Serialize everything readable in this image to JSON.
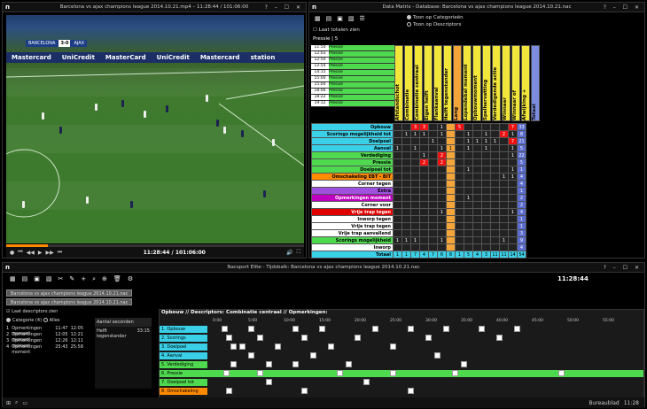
{
  "video": {
    "title": "Barcelona vs ajax champions league 2014.10.21.mp4 – 11:28:44 / 101:06:00",
    "logo": "n",
    "controls": "?  –  ☐  ✕",
    "time": "11:28:44 / 101:06:00",
    "score_home": "BARCELONA",
    "score_num": "3-0",
    "score_away": "AJAX",
    "ads": [
      "Mastercard",
      "UniCredit",
      "MasterCard",
      "UniCredit",
      "Mastercard",
      "station"
    ],
    "progress": 0.14
  },
  "matrix": {
    "title": "Data Matrix - Database: Barcelona vs ajax champions league 2014.10.21.nac",
    "logo": "n",
    "controls": "?  –  ☐  ✕",
    "radio1": "Toon op Categorieën",
    "radio2": "Toon op Descriptors",
    "checkbox": "Laat totalen zien",
    "sub": "Pressie | 5",
    "playlist": [
      [
        "11:50",
        "Pressie"
      ],
      [
        "12:03",
        "Pressie"
      ],
      [
        "12:50",
        "Pressie"
      ],
      [
        "12:54",
        "Pressie"
      ],
      [
        "14:15",
        "Pressie"
      ],
      [
        "15:00",
        "Pressie"
      ],
      [
        "15:04",
        "Pressie"
      ],
      [
        "18:06",
        "Pressie"
      ],
      [
        "18:22",
        "Pressie"
      ],
      [
        "19:12",
        "Pressie"
      ]
    ],
    "columns": [
      "Afstandschot",
      "Combinatie",
      "Combinatie centraal",
      "Eigen helft",
      "Flankaanval",
      "Helft tegenstander",
      "Lang",
      "Lopendebal moment",
      "Opbouwmoment",
      "Spelhervatting",
      "Verdedigende actie",
      "Winnaar",
      "Winnaar of",
      "Afwijking +",
      "Totaal"
    ],
    "rows": [
      {
        "label": "Opbouw",
        "color": "#3ad1e8",
        "cells": [
          "",
          "",
          "3",
          "3",
          "",
          "1",
          "",
          "5",
          "",
          "",
          "",
          "",
          "",
          "7",
          "33"
        ]
      },
      {
        "label": "Scorings mogelijkheid tot",
        "color": "#3ad1e8",
        "cells": [
          "",
          "1",
          "1",
          "1",
          "",
          "1",
          "",
          "",
          "1",
          "",
          "1",
          "",
          "2",
          "1",
          "8"
        ]
      },
      {
        "label": "Doelpoel",
        "color": "#3ad1e8",
        "cells": [
          "",
          "",
          "",
          "",
          "1",
          "",
          "",
          "",
          "1",
          "1",
          "1",
          "1",
          "",
          "7",
          "21"
        ]
      },
      {
        "label": "Aanval",
        "color": "#3ad1e8",
        "cells": [
          "1",
          "",
          "1",
          "",
          "",
          "1",
          "1",
          "",
          "1",
          "",
          "1",
          "",
          "",
          "1",
          "5"
        ]
      },
      {
        "label": "Verdediging",
        "color": "#4fd94f",
        "cells": [
          "",
          "",
          "",
          "1",
          "",
          "2",
          "",
          "",
          "",
          "",
          "",
          "",
          "",
          "1",
          "22"
        ]
      },
      {
        "label": "Pressie",
        "color": "#4fd94f",
        "cells": [
          "",
          "",
          "",
          "2",
          "",
          "2",
          "",
          "",
          "",
          "",
          "",
          "",
          "",
          "",
          "5"
        ]
      },
      {
        "label": "Doelpoel tot",
        "color": "#4fd94f",
        "cells": [
          "",
          "",
          "",
          "",
          "",
          "",
          "",
          "",
          "1",
          "",
          "",
          "",
          "",
          "1",
          "1"
        ]
      },
      {
        "label": "Omschakeling EBT - BIT",
        "color": "#ff8a00",
        "cells": [
          "",
          "",
          "",
          "",
          "",
          "",
          "",
          "",
          "",
          "",
          "",
          "",
          "1",
          "1",
          "4"
        ]
      },
      {
        "label": "Corner tegen",
        "color": "#fff",
        "cells": [
          "",
          "",
          "",
          "",
          "",
          "",
          "",
          "",
          "",
          "",
          "",
          "",
          "",
          "",
          "4"
        ]
      },
      {
        "label": "Extra",
        "color": "#a050e0",
        "cells": [
          "",
          "",
          "",
          "",
          "",
          "",
          "",
          "",
          "",
          "",
          "",
          "",
          "",
          "",
          "1"
        ]
      },
      {
        "label": "Opmerkingen moment",
        "color": "#c000c0",
        "cells": [
          "",
          "",
          "",
          "",
          "",
          "",
          "",
          "",
          "1",
          "",
          "",
          "",
          "",
          "",
          "2"
        ]
      },
      {
        "label": "Corner voor",
        "color": "#fff",
        "cells": [
          "",
          "",
          "",
          "",
          "",
          "",
          "",
          "",
          "",
          "",
          "",
          "",
          "",
          "",
          "2"
        ]
      },
      {
        "label": "Vrije trap tegen",
        "color": "#e00000",
        "cells": [
          "",
          "",
          "",
          "",
          "",
          "1",
          "",
          "",
          "",
          "",
          "",
          "",
          "",
          "1",
          "4"
        ]
      },
      {
        "label": "Inworp tegen",
        "color": "#fff",
        "cells": [
          "",
          "",
          "",
          "",
          "",
          "",
          "",
          "",
          "",
          "",
          "",
          "",
          "",
          "",
          "1"
        ]
      },
      {
        "label": "Vrije trap tegen",
        "color": "#fff",
        "cells": [
          "",
          "",
          "",
          "",
          "",
          "",
          "",
          "",
          "",
          "",
          "",
          "",
          "",
          "",
          "1"
        ]
      },
      {
        "label": "Vrije trap aanvallend",
        "color": "#fff",
        "cells": [
          "",
          "",
          "",
          "",
          "",
          "",
          "",
          "",
          "",
          "",
          "",
          "",
          "",
          "",
          "3"
        ]
      },
      {
        "label": "Scorings mogelijkheid",
        "color": "#4fd94f",
        "cells": [
          "1",
          "1",
          "1",
          "",
          "",
          "1",
          "",
          "",
          "",
          "",
          "",
          "",
          "1",
          "",
          "9"
        ]
      },
      {
        "label": "Inworp",
        "color": "#fff",
        "cells": [
          "",
          "",
          "",
          "",
          "",
          "",
          "",
          "",
          "",
          "",
          "",
          "",
          "",
          "",
          "4"
        ]
      },
      {
        "label": "Totaal",
        "color": "#3ad1e8",
        "cells": [
          "1",
          "1",
          "7",
          "4",
          "7",
          "6",
          "8",
          "1",
          "5",
          "4",
          "3",
          "11",
          "11",
          "14",
          "54"
        ]
      }
    ]
  },
  "bottom": {
    "title": "Nacsport Elite - Tijdsbalk: Barcelona vs ajax champions league 2014.10.21.nac",
    "logo": "n",
    "controls": "?  –  ☐  ✕",
    "clock": "11:28:44",
    "tab1": "Barcelona vs ajax champions league 2014.10.21.nac",
    "tab2": "Barcelona vs ajax champions league 2014.10.21.nac",
    "checkbox": "Laat descriptors zien",
    "filter1": "Categorie (4)",
    "filter2": "Alles",
    "list": [
      [
        "1",
        "Opmerkingen moment",
        "11:47",
        "12:05"
      ],
      [
        "2",
        "Opmerkingen moment",
        "12:05",
        "12:21"
      ],
      [
        "3",
        "Opmerkingen moment",
        "12:26",
        "12:11"
      ],
      [
        "4",
        "Opmerkingen moment",
        "25:43",
        "25:58"
      ]
    ],
    "mid_header": "Aantal seconden",
    "mid_row_label": "Helft tegenstander",
    "mid_row_value": "33:15",
    "timeline_header": "Opbouw // Descriptors: Combinatie centraal // Opmerkingen:",
    "ticks": [
      "0:00",
      "5:00",
      "10:00",
      "15:00",
      "20:00",
      "25:00",
      "30:00",
      "35:00",
      "40:00",
      "45:00",
      "50:00",
      "55:00"
    ],
    "lanes": [
      {
        "name": "1. Opbouw",
        "color": "#3ad1e8"
      },
      {
        "name": "2. Scorings mogelijkheid",
        "color": "#3ad1e8"
      },
      {
        "name": "3. Doelpoel",
        "color": "#3ad1e8"
      },
      {
        "name": "4. Aanval",
        "color": "#3ad1e8"
      },
      {
        "name": "5. Verdediging",
        "color": "#4fd94f"
      },
      {
        "name": "6. Pressie",
        "color": "#4fd94f"
      },
      {
        "name": "7. Doelpoel tot",
        "color": "#4fd94f"
      },
      {
        "name": "8. Omschakeling",
        "color": "#ff8a00"
      }
    ],
    "taskbar_time": "11:28",
    "taskbar_label": "Bureaublad"
  }
}
